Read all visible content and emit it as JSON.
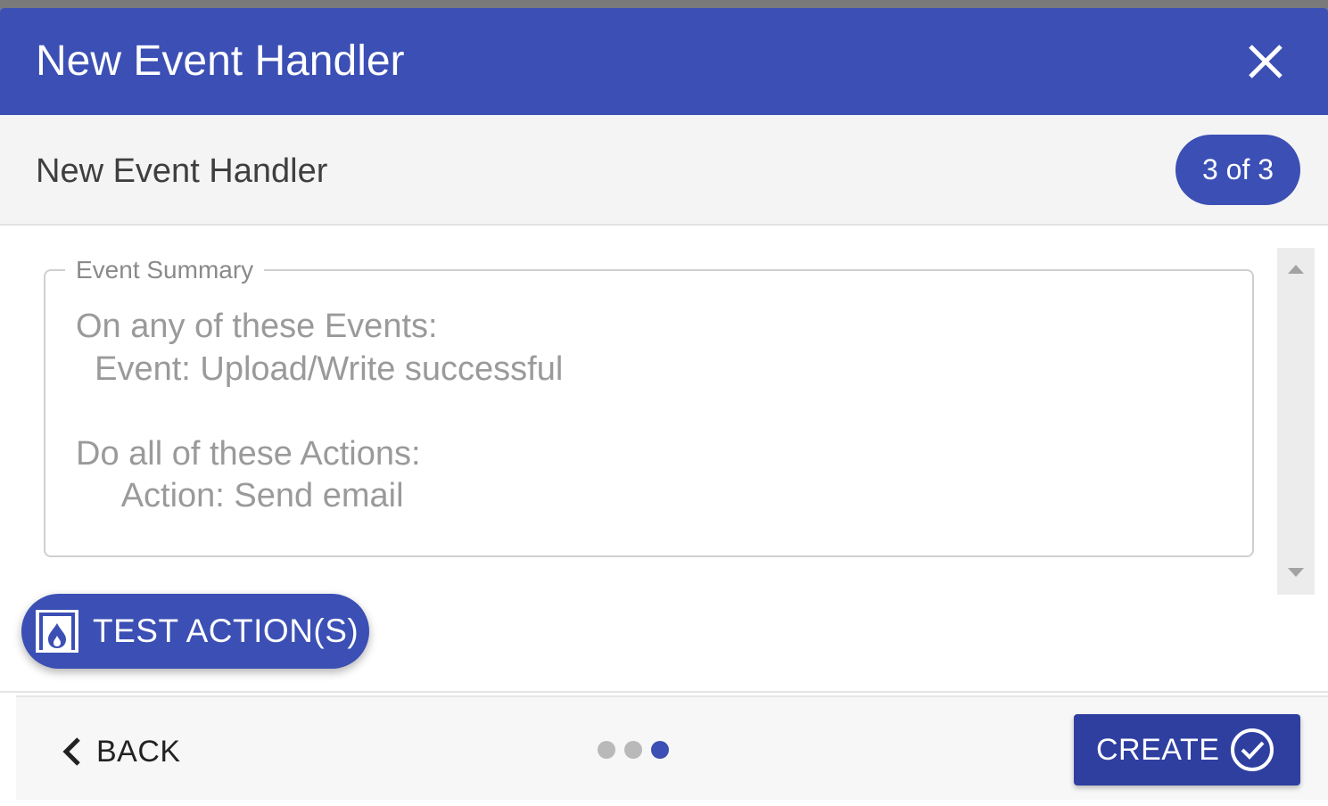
{
  "dialog": {
    "title": "New Event Handler",
    "close_icon": "close-icon"
  },
  "subheader": {
    "title": "New Event Handler",
    "step_badge": "3 of 3"
  },
  "summary": {
    "legend": "Event Summary",
    "text": "On any of these Events:\n  Event: Upload/Write successful\n\nDo all of these Actions:\n     Action: Send email"
  },
  "test_button": {
    "label": "TEST ACTION(S)",
    "icon": "test-flame-icon"
  },
  "footer": {
    "back_label": "BACK",
    "back_icon": "chevron-left-icon",
    "steps_total": 3,
    "steps_current": 3,
    "create_label": "CREATE",
    "create_icon": "check-circle-icon"
  },
  "colors": {
    "primary": "#3b4fb4",
    "create_button": "#2f3fa0",
    "dot_inactive": "#b9b9b9"
  }
}
